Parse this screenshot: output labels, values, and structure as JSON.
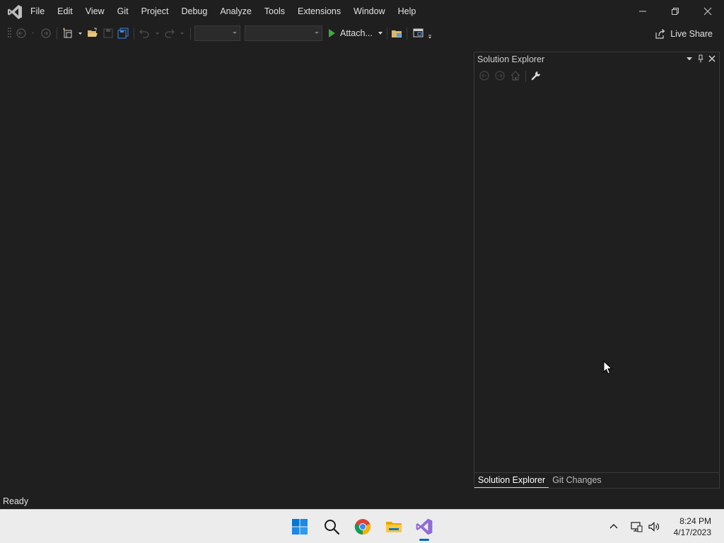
{
  "menu": {
    "items": [
      "File",
      "Edit",
      "View",
      "Git",
      "Project",
      "Debug",
      "Analyze",
      "Tools",
      "Extensions",
      "Window",
      "Help"
    ]
  },
  "toolbar": {
    "attach_label": "Attach...",
    "live_share_label": "Live Share"
  },
  "solution_explorer": {
    "title": "Solution Explorer",
    "tabs": [
      "Solution Explorer",
      "Git Changes"
    ]
  },
  "status": {
    "text": "Ready"
  },
  "taskbar": {
    "time": "8:24 PM",
    "date": "4/17/2023"
  },
  "colors": {
    "background": "#1f1f1f",
    "accent_vs": "#8f6ad8",
    "play_green": "#3ea83e",
    "taskbar_bg": "#ececec",
    "windows_blue": "#0078d4"
  },
  "icons": {
    "title": [
      "visual-studio-logo-icon",
      "minimize-icon",
      "restore-icon",
      "close-icon"
    ],
    "toolbar": [
      "gripper-icon",
      "back-icon",
      "forward-icon",
      "new-project-icon",
      "open-file-icon",
      "save-icon",
      "save-all-icon",
      "undo-icon",
      "redo-icon",
      "play-icon",
      "file-explorer-icon",
      "layout-icon",
      "live-share-icon"
    ],
    "solution_explorer": [
      "dropdown-icon",
      "pin-icon",
      "close-icon",
      "back-icon",
      "forward-icon",
      "home-icon",
      "wrench-icon"
    ],
    "taskbar": [
      "windows-start-icon",
      "search-icon",
      "chrome-icon",
      "file-explorer-icon",
      "visual-studio-icon",
      "chevron-up-icon",
      "network-icon",
      "volume-icon"
    ]
  }
}
